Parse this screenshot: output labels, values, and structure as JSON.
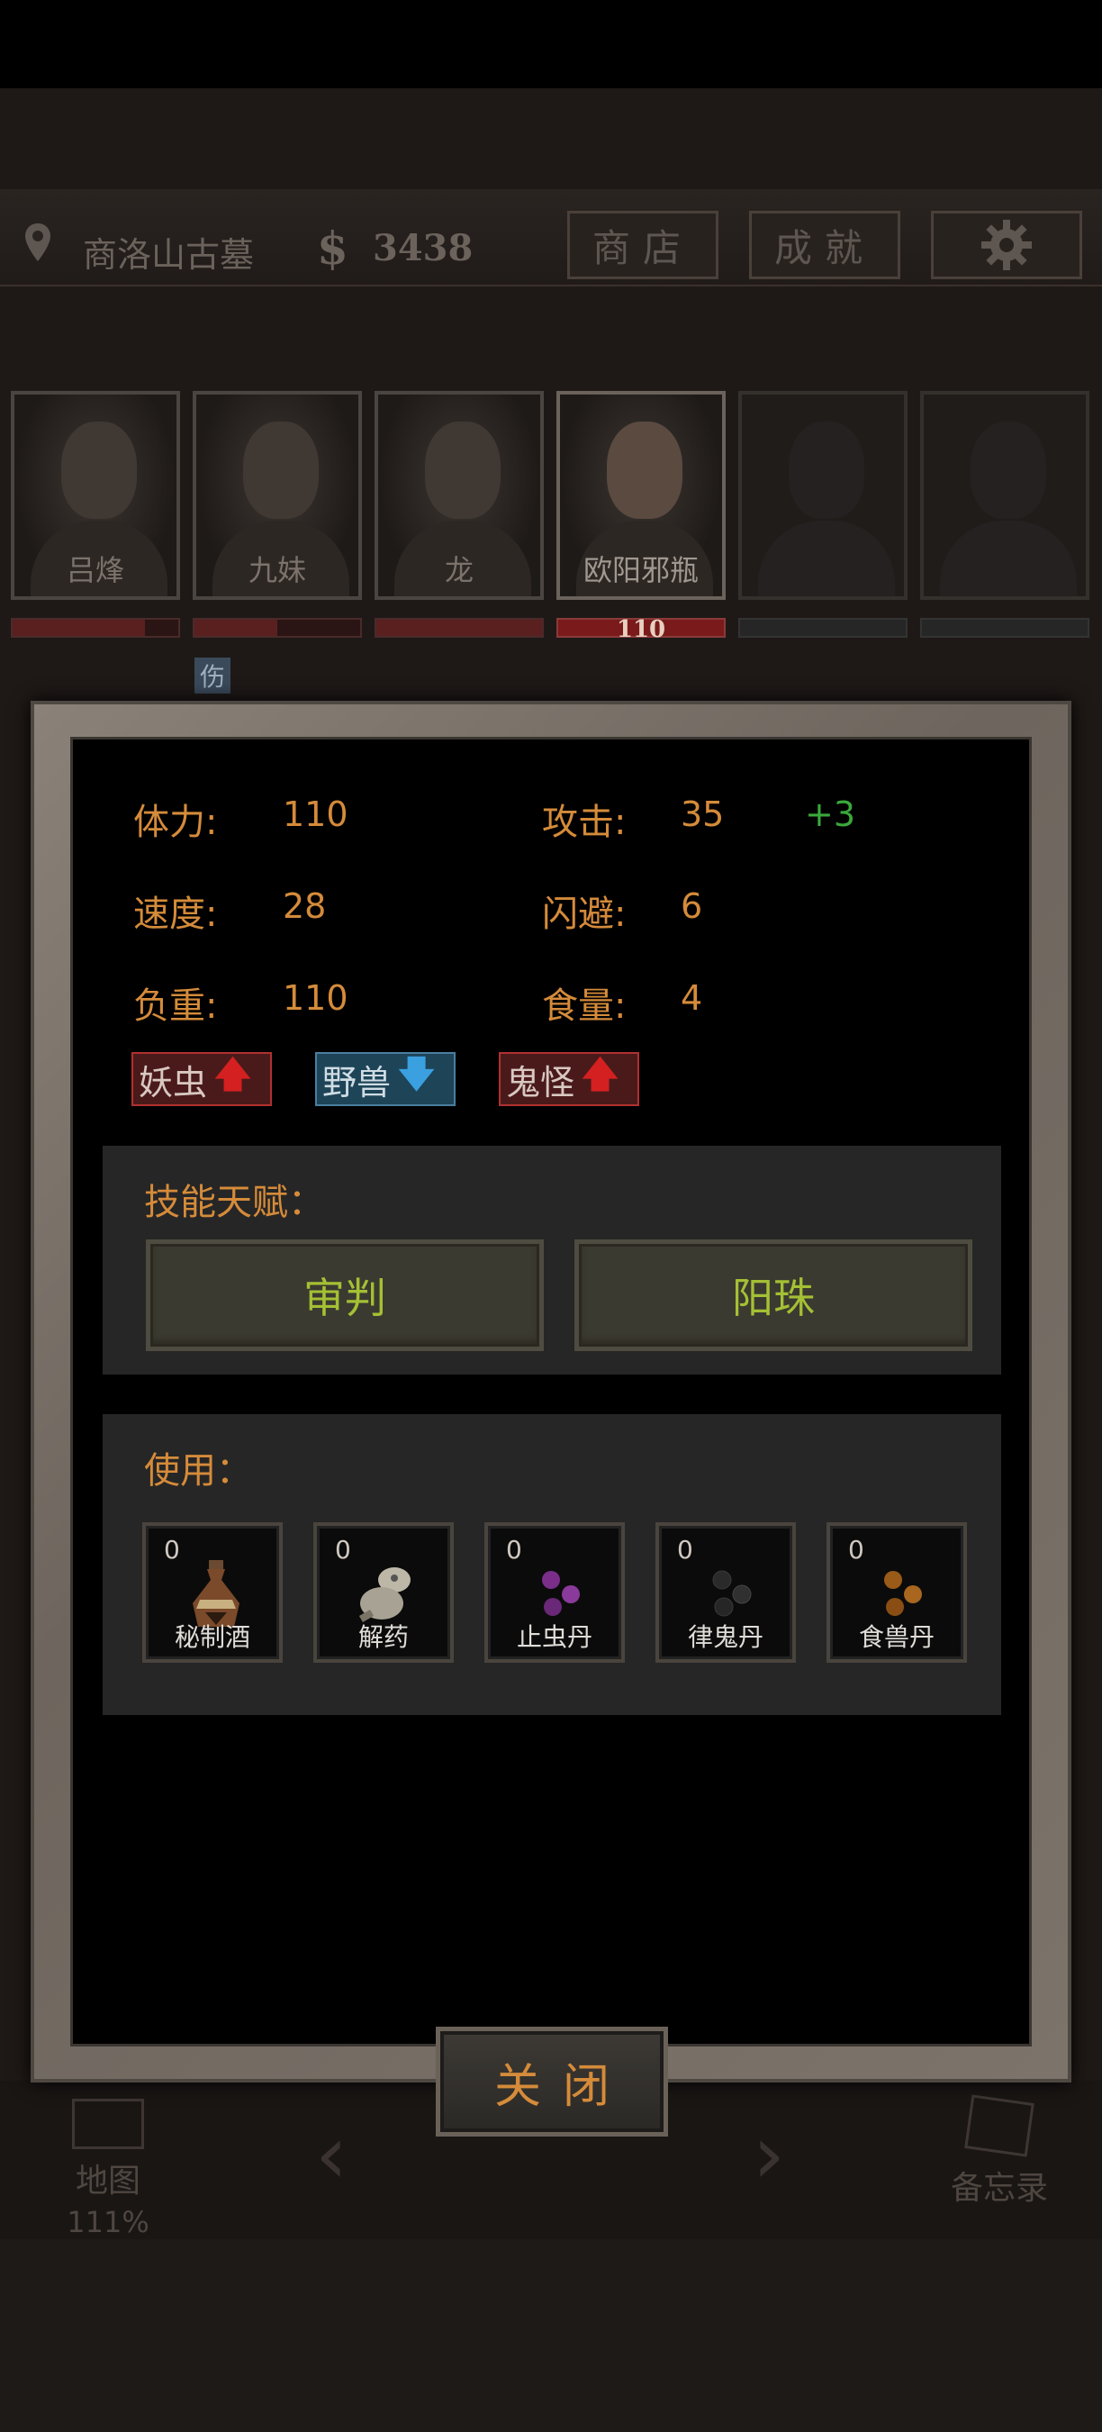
{
  "hud": {
    "location": "商洛山古墓",
    "money": "3438",
    "shop_label": "商店",
    "achievements_label": "成就",
    "settings_icon": "gear-icon"
  },
  "team": [
    {
      "name": "吕烽",
      "hp_fill": 0.8
    },
    {
      "name": "九妹",
      "hp_fill": 0.5
    },
    {
      "name": "龙",
      "hp_fill": 1.0
    },
    {
      "name": "欧阳邪瓶",
      "hp_label": "110",
      "hp_fill": 1.0
    },
    {
      "name": "",
      "hp_fill": 0
    },
    {
      "name": "",
      "hp_fill": 0
    }
  ],
  "status_tag": "伤",
  "stats": {
    "stamina_label": "体力:",
    "stamina": "110",
    "attack_label": "攻击:",
    "attack": "35",
    "attack_bonus": "+3",
    "speed_label": "速度:",
    "speed": "28",
    "dodge_label": "闪避:",
    "dodge": "6",
    "load_label": "负重:",
    "load": "110",
    "food_label": "食量:",
    "food": "4"
  },
  "affinities": [
    {
      "label": "妖虫",
      "direction": "up",
      "color": "#d42020"
    },
    {
      "label": "野兽",
      "direction": "down",
      "color": "#3aa0e0"
    },
    {
      "label": "鬼怪",
      "direction": "up",
      "color": "#d42020"
    }
  ],
  "skills": {
    "title": "技能天赋：",
    "items": [
      "审判",
      "阳珠"
    ]
  },
  "use": {
    "title": "使用：",
    "items": [
      {
        "label": "秘制酒",
        "count": "0",
        "icon": "wine-jar-icon"
      },
      {
        "label": "解药",
        "count": "0",
        "icon": "antidote-gourd-icon"
      },
      {
        "label": "止虫丹",
        "count": "0",
        "icon": "purple-pills-icon"
      },
      {
        "label": "律鬼丹",
        "count": "0",
        "icon": "black-pills-icon"
      },
      {
        "label": "食兽丹",
        "count": "0",
        "icon": "orange-pills-icon"
      }
    ]
  },
  "close_label": "关闭",
  "nav": {
    "map_label": "地图",
    "map_percent": "111%",
    "memo_label": "备忘录"
  },
  "colors": {
    "stat_text": "#d58b3a",
    "bonus_green": "#3aa83a",
    "skill_text": "#a4c034"
  }
}
